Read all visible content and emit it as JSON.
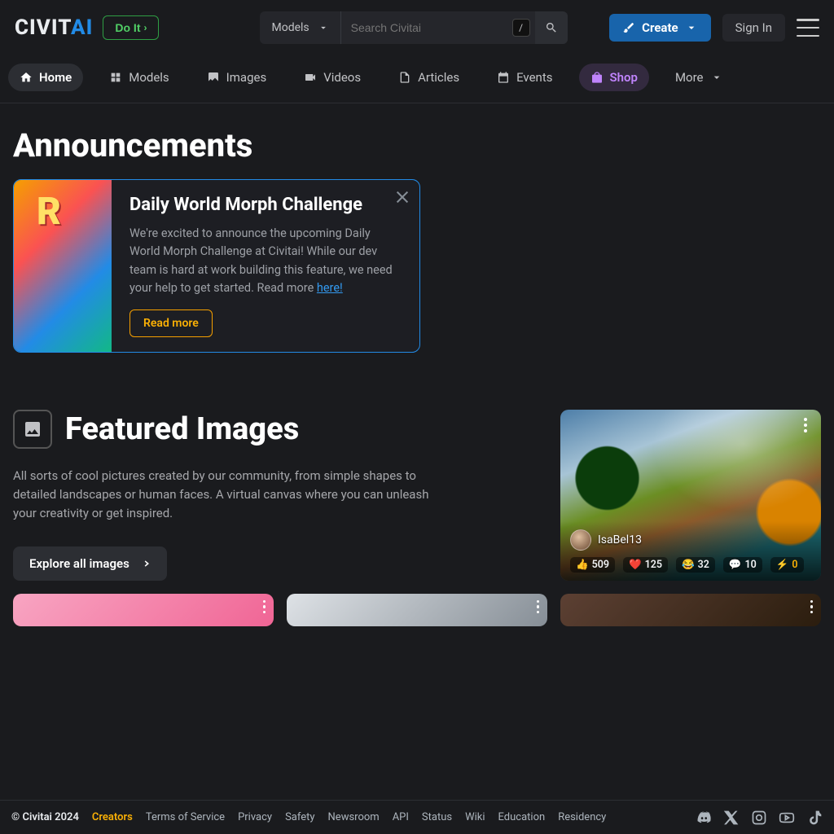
{
  "header": {
    "logo_part1": "CIVIT",
    "logo_part2": "AI",
    "do_it": "Do It",
    "search_category": "Models",
    "search_placeholder": "Search Civitai",
    "slash": "/",
    "create": "Create",
    "sign_in": "Sign In"
  },
  "nav": {
    "items": [
      {
        "label": "Home",
        "icon": "home",
        "state": "active"
      },
      {
        "label": "Models",
        "icon": "grid",
        "state": ""
      },
      {
        "label": "Images",
        "icon": "image",
        "state": ""
      },
      {
        "label": "Videos",
        "icon": "video",
        "state": ""
      },
      {
        "label": "Articles",
        "icon": "file",
        "state": ""
      },
      {
        "label": "Events",
        "icon": "cal",
        "state": ""
      },
      {
        "label": "Shop",
        "icon": "shop",
        "state": "shop"
      }
    ],
    "more": "More"
  },
  "announcements": {
    "heading": "Announcements",
    "card": {
      "title": "Daily World Morph Challenge",
      "body": "We're excited to announce the upcoming Daily World Morph Challenge at Civitai! While our dev team is hard at work building this feature, we need your help to get started. Read more ",
      "link_text": "here!",
      "button": "Read more"
    }
  },
  "featured": {
    "title": "Featured Images",
    "desc": "All sorts of cool pictures created by our community, from simple shapes to detailed landscapes or human faces. A virtual canvas where you can unleash your creativity or get inspired.",
    "button": "Explore all images",
    "card": {
      "user": "IsaBel13",
      "stats": {
        "reactions": "509",
        "likes": "125",
        "laugh": "32",
        "comments": "10",
        "tips": "0"
      }
    }
  },
  "footer": {
    "copyright": "© Civitai 2024",
    "links": [
      "Creators",
      "Terms of Service",
      "Privacy",
      "Safety",
      "Newsroom",
      "API",
      "Status",
      "Wiki",
      "Education",
      "Residency"
    ]
  }
}
